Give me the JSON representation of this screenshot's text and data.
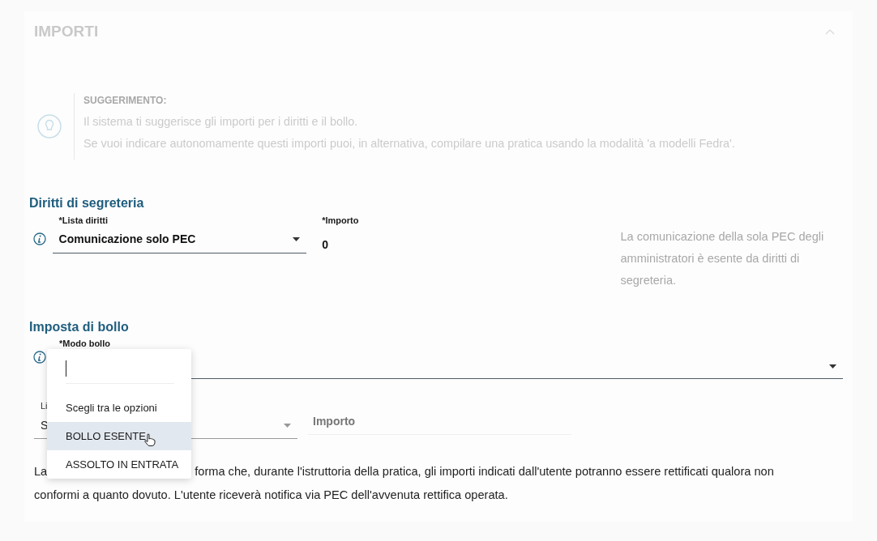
{
  "section": {
    "title": "IMPORTI",
    "expanded": true
  },
  "hint": {
    "title": "SUGGERIMENTO:",
    "lines": [
      "Il sistema ti suggerisce gli importi per i diritti e il bollo.",
      "Se vuoi indicare autonomamente questi importi puoi, in alternativa, compilare una pratica usando la modalità 'a modelli Fedra'."
    ]
  },
  "diritti": {
    "heading": "Diritti di segreteria",
    "list_label": "*Lista diritti",
    "list_value": "Comunicazione solo PEC",
    "amount_label": "*Importo",
    "amount_value": "0",
    "note": "La comunicazione della sola PEC degli amministratori è esente da diritti di segreteria."
  },
  "bollo": {
    "heading": "Imposta di bollo",
    "mode_label": "*Modo bollo",
    "list_label": "Li",
    "list_value": "S",
    "amount_placeholder": "Importo"
  },
  "dropdown": {
    "options": [
      {
        "label": "Scegli tra le opzioni",
        "hovered": false
      },
      {
        "label": "BOLLO ESENTE",
        "hovered": true
      },
      {
        "label": "ASSOLTO IN ENTRATA",
        "hovered": false
      }
    ]
  },
  "notice": {
    "line_1_start": "La",
    "line_1_end": "forma che, durante l'istruttoria della pratica, gli importi indicati dall'utente potranno essere rettificati qualora non",
    "line_2": "conformi a quanto dovuto. L'utente riceverà notifica via PEC dell'avvenuta rettifica operata."
  }
}
